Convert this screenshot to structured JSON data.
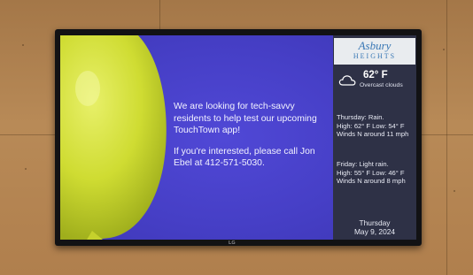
{
  "sidebar": {
    "logo": {
      "name": "Asbury",
      "sub": "HEIGHTS"
    },
    "current": {
      "temperature": "62° F",
      "condition": "Overcast clouds",
      "icon": "cloud-icon"
    },
    "forecast": [
      {
        "day": "Thursday:",
        "summary": "Rain.",
        "detail": "High: 62° F Low: 54° F Winds N around 11 mph"
      },
      {
        "day": "Friday:",
        "summary": "Light rain.",
        "detail": "High: 55° F Low: 46° F Winds N around 8 mph"
      }
    ],
    "date": {
      "weekday": "Thursday",
      "full": "May 9, 2024"
    }
  },
  "announcement": {
    "line1": "We are looking for tech-savvy residents to help test our upcoming TouchTown app!",
    "line2": "If you're interested, please call Jon Ebel at 412-571-5030."
  },
  "tv": {
    "brand": "LG"
  },
  "colors": {
    "screen_background": "#4a43c9",
    "sidebar_background": "#2e3146",
    "balloon": "#d4e23a",
    "logo_blue": "#3a78b5",
    "wall": "#b08452"
  }
}
